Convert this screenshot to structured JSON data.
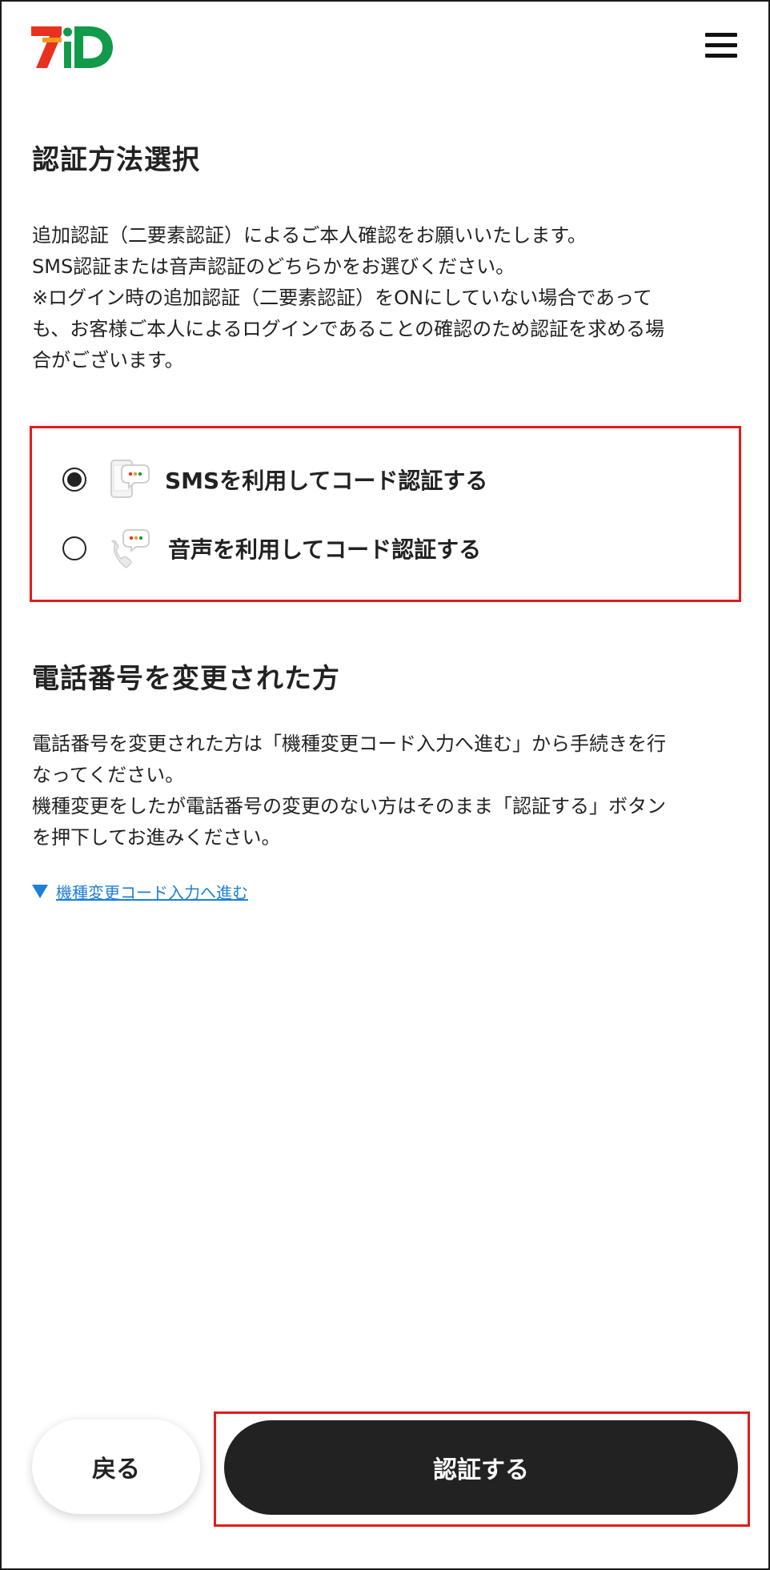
{
  "header": {
    "logo_text": "7iD",
    "menu_icon": "hamburger-menu-icon",
    "brand_colors": {
      "seven_red": "#e8321f",
      "seven_orange": "#f39a1e",
      "id_green": "#119a4a"
    }
  },
  "auth_section": {
    "title": "認証方法選択",
    "description_lines": [
      "追加認証（二要素認証）によるご本人確認をお願いいたします。",
      "SMS認証または音声認証のどちらかをお選びください。",
      "※ログイン時の追加認証（二要素認証）をONにしていない場合であって",
      "も、お客様ご本人によるログインであることの確認のため認証を求める場",
      "合がございます。"
    ]
  },
  "options": [
    {
      "label": "SMSを利用してコード認証する",
      "icon": "sms-phone-icon",
      "selected": true
    },
    {
      "label": "音声を利用してコード認証する",
      "icon": "voice-call-icon",
      "selected": false
    }
  ],
  "phone_change": {
    "title": "電話番号を変更された方",
    "description_lines": [
      "電話番号を変更された方は「機種変更コード入力へ進む」から手続きを行",
      "なってください。",
      "機種変更をしたが電話番号の変更のない方はそのまま「認証する」ボタン",
      "を押下してお進みください。"
    ],
    "link_label": "機種変更コード入力へ進む"
  },
  "buttons": {
    "back": "戻る",
    "authenticate": "認証する"
  },
  "colors": {
    "highlight": "#e21b1b",
    "link": "#1e7fd8",
    "primary_button": "#222222"
  }
}
